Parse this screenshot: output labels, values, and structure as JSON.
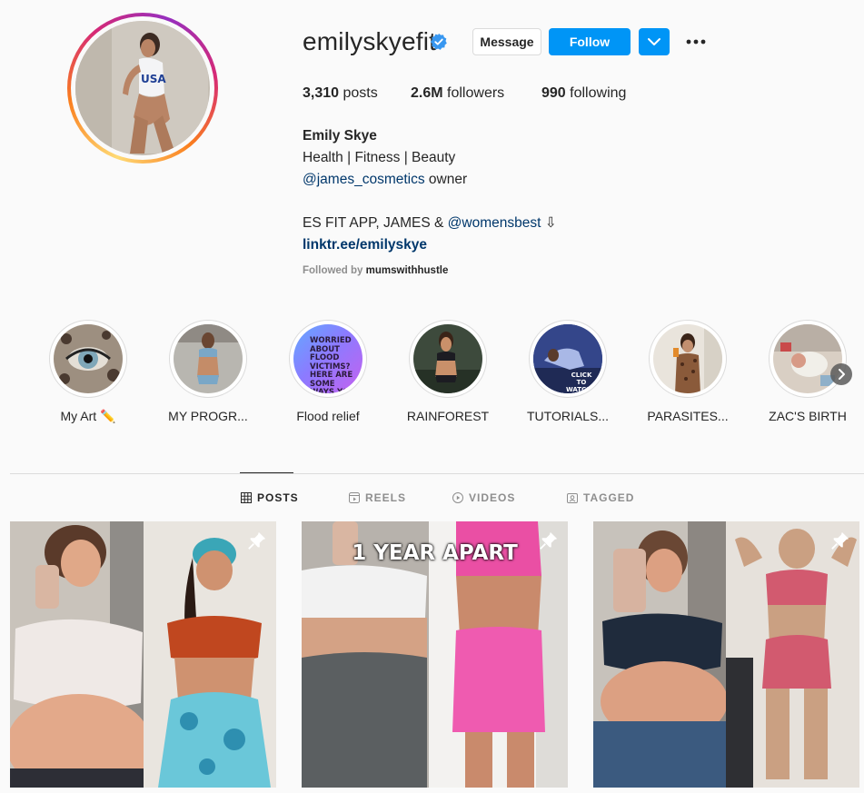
{
  "profile": {
    "username": "emilyskyefit",
    "verified": true,
    "message_label": "Message",
    "follow_label": "Follow",
    "posts_count": "3,310",
    "posts_label": "posts",
    "followers_count": "2.6M",
    "followers_label": "followers",
    "following_count": "990",
    "following_label": "following",
    "full_name": "Emily Skye",
    "bio_line1": "Health | Fitness | Beauty",
    "bio_mention1": "@james_cosmetics",
    "bio_line2_rest": " owner",
    "bio_line3_prefix": "ES FIT APP, JAMES & ",
    "bio_mention2": "@womensbest",
    "bio_line3_suffix": " ⇩",
    "link": "linktr.ee/emilyskye",
    "followed_by_prefix": "Followed by ",
    "followed_by_user": "mumswithhustle",
    "accent_color": "#0095f6"
  },
  "highlights": [
    {
      "label": "My Art ✏️",
      "icon": "leopard-eye"
    },
    {
      "label": "MY PROGR...",
      "icon": "progress-photo"
    },
    {
      "label": "Flood relief",
      "icon": "flood-text",
      "text": "WORRIED ABOUT FLOOD VICTIMS? HERE ARE SOME WAYS YOU CAN HELP"
    },
    {
      "label": "RAINFOREST",
      "icon": "rainforest-photo"
    },
    {
      "label": "TUTORIALS...",
      "icon": "tutorial-photo",
      "text": "CLICK TO WATCH!!"
    },
    {
      "label": "PARASITES...",
      "icon": "parasites-photo"
    },
    {
      "label": "ZAC'S BIRTH",
      "icon": "baby-photo"
    }
  ],
  "tabs": [
    {
      "label": "POSTS",
      "icon": "grid-icon",
      "active": true
    },
    {
      "label": "REELS",
      "icon": "reels-icon",
      "active": false
    },
    {
      "label": "VIDEOS",
      "icon": "play-icon",
      "active": false
    },
    {
      "label": "TAGGED",
      "icon": "tag-icon",
      "active": false
    }
  ],
  "posts": [
    {
      "overlay": "",
      "pinned": true
    },
    {
      "overlay": "1 YEAR APART",
      "pinned": true
    },
    {
      "overlay": "",
      "pinned": true
    }
  ]
}
